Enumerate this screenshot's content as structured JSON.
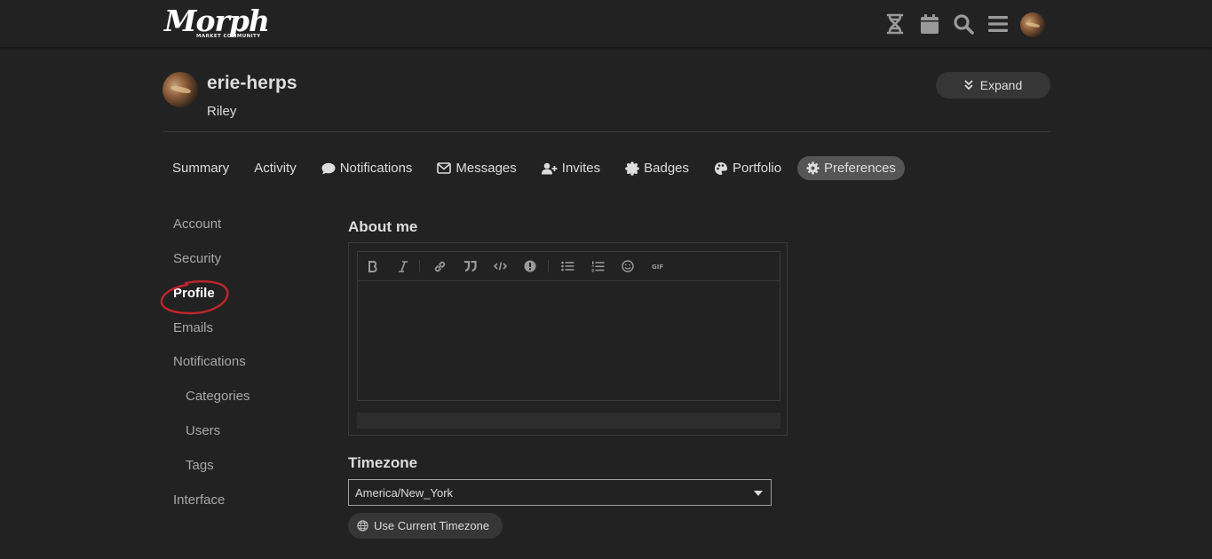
{
  "header": {
    "logo_text": "Morph",
    "logo_subtitle": "MARKET COMMUNITY",
    "icons": [
      "dna-icon",
      "calendar-icon",
      "search-icon",
      "hamburger-menu-icon",
      "user-avatar"
    ]
  },
  "user": {
    "username": "erie-herps",
    "name": "Riley",
    "expand_label": "Expand"
  },
  "tabs": [
    {
      "label": "Summary",
      "icon": ""
    },
    {
      "label": "Activity",
      "icon": ""
    },
    {
      "label": "Notifications",
      "icon": "comment-icon"
    },
    {
      "label": "Messages",
      "icon": "envelope-icon"
    },
    {
      "label": "Invites",
      "icon": "user-plus-icon"
    },
    {
      "label": "Badges",
      "icon": "badge-icon"
    },
    {
      "label": "Portfolio",
      "icon": "palette-icon"
    },
    {
      "label": "Preferences",
      "icon": "gear-icon",
      "active": true
    }
  ],
  "sidenav": [
    {
      "label": "Account"
    },
    {
      "label": "Security"
    },
    {
      "label": "Profile",
      "active": true
    },
    {
      "label": "Emails"
    },
    {
      "label": "Notifications"
    },
    {
      "label": "Categories",
      "sub": true
    },
    {
      "label": "Users",
      "sub": true
    },
    {
      "label": "Tags",
      "sub": true
    },
    {
      "label": "Interface"
    }
  ],
  "about_me": {
    "label": "About me",
    "toolbar": [
      "bold-icon",
      "italic-icon",
      "link-icon",
      "quote-icon",
      "code-icon",
      "hide-details-icon",
      "bullet-list-icon",
      "numbered-list-icon",
      "emoji-icon",
      "gif-icon"
    ],
    "value": ""
  },
  "timezone": {
    "label": "Timezone",
    "selected": "America/New_York",
    "use_current_label": "Use Current Timezone"
  },
  "colors": {
    "background": "#222222",
    "active_tab": "#555555",
    "annotation_circle": "#c0262c"
  }
}
